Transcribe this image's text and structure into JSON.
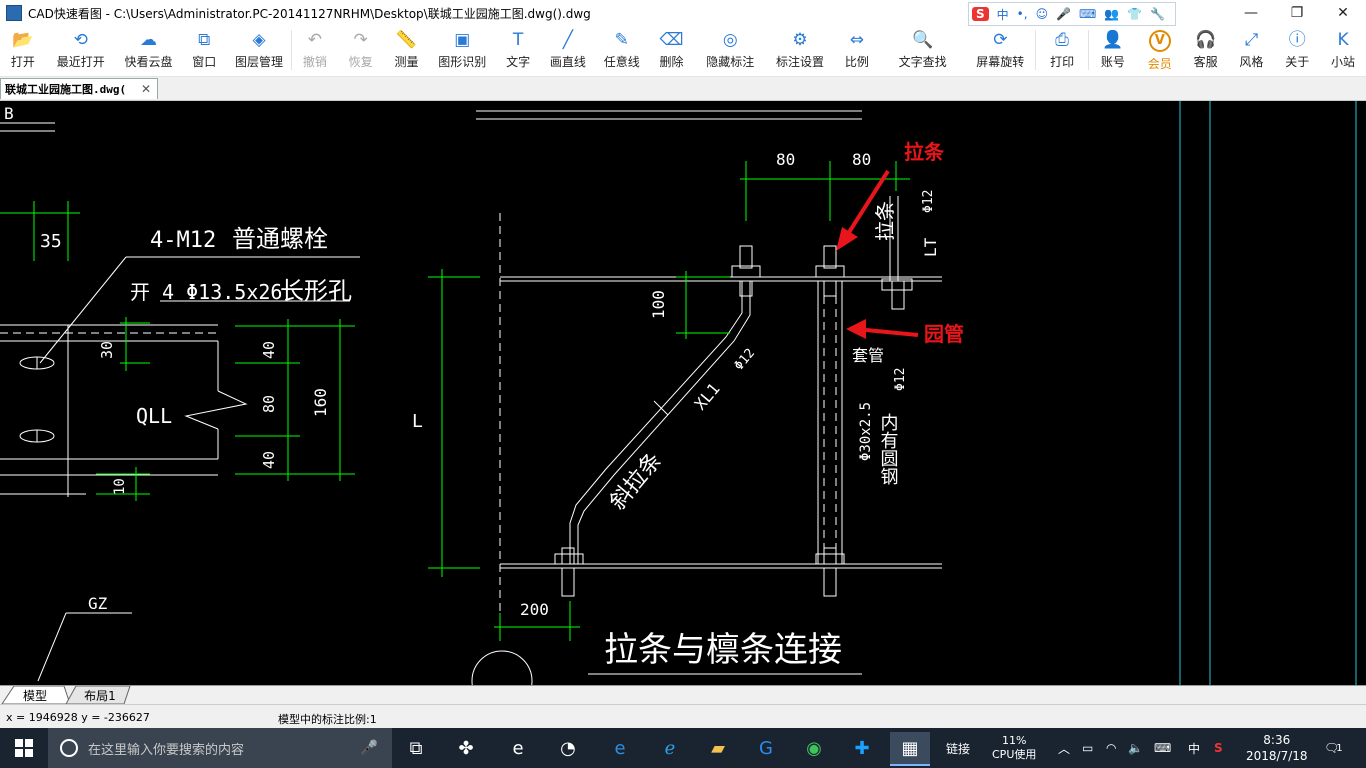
{
  "window": {
    "title": "CAD快速看图 - C:\\Users\\Administrator.PC-20141127NRHM\\Desktop\\联城工业园施工图.dwg().dwg",
    "minimize": "—",
    "maximize": "❐",
    "close": "✕"
  },
  "ime": {
    "logo": "S",
    "mode": "中",
    "punct": "•,"
  },
  "toolbar": {
    "items": [
      {
        "label": "打开",
        "icon": "folder-icon",
        "glyph": "📂"
      },
      {
        "label": "最近打开",
        "icon": "history-icon",
        "glyph": "⟲"
      },
      {
        "label": "快看云盘",
        "icon": "cloud-icon",
        "glyph": "☁"
      },
      {
        "label": "窗口",
        "icon": "window-icon",
        "glyph": "⧉"
      },
      {
        "label": "图层管理",
        "icon": "layers-icon",
        "glyph": "◈"
      },
      {
        "label": "撤销",
        "icon": "undo-icon",
        "glyph": "↶"
      },
      {
        "label": "恢复",
        "icon": "redo-icon",
        "glyph": "↷"
      },
      {
        "label": "测量",
        "icon": "ruler-icon",
        "glyph": "📏"
      },
      {
        "label": "图形识别",
        "icon": "shape-recognize-icon",
        "glyph": "▣"
      },
      {
        "label": "文字",
        "icon": "text-icon",
        "glyph": "T"
      },
      {
        "label": "画直线",
        "icon": "line-icon",
        "glyph": "╱"
      },
      {
        "label": "任意线",
        "icon": "pen-icon",
        "glyph": "✎"
      },
      {
        "label": "删除",
        "icon": "eraser-icon",
        "glyph": "⌫"
      },
      {
        "label": "隐藏标注",
        "icon": "eye-hide-icon",
        "glyph": "◎"
      },
      {
        "label": "标注设置",
        "icon": "gear-icon",
        "glyph": "⚙"
      },
      {
        "label": "比例",
        "icon": "scale-icon",
        "glyph": "⇔"
      },
      {
        "label": "文字查找",
        "icon": "text-search-icon",
        "glyph": "🔍"
      },
      {
        "label": "屏幕旋转",
        "icon": "rotate-icon",
        "glyph": "⟳"
      },
      {
        "label": "打印",
        "icon": "printer-icon",
        "glyph": "⎙"
      },
      {
        "label": "账号",
        "icon": "user-icon",
        "glyph": "👤"
      },
      {
        "label": "会员",
        "icon": "vip-icon",
        "glyph": "V"
      },
      {
        "label": "客服",
        "icon": "headset-icon",
        "glyph": "🎧"
      },
      {
        "label": "风格",
        "icon": "style-icon",
        "glyph": "⤢"
      },
      {
        "label": "关于",
        "icon": "info-icon",
        "glyph": "ⓘ"
      },
      {
        "label": "小站",
        "icon": "site-icon",
        "glyph": "K"
      }
    ]
  },
  "doctab": {
    "label": "联城工业园施工图.dwg(",
    "close": "✕"
  },
  "drawing": {
    "dim_80_left": "80",
    "dim_80_right": "80",
    "annot_tiaotiao": "拉条",
    "annot_yuanguan": "园管",
    "label_4m12": "4-M12",
    "label_bolt": "普通螺栓",
    "label_hole": "开 4 Φ13.5x26",
    "label_slot": "长形孔",
    "dim_35": "35",
    "dim_30": "30",
    "dim_40_top": "40",
    "dim_80_mid": "80",
    "dim_160": "160",
    "dim_40_bot": "40",
    "dim_10": "10",
    "label_qll": "QLL",
    "dim_100": "100",
    "label_L": "L",
    "label_LT": "LT",
    "label_xl1": "XL1",
    "label_phi12_a": "Φ12",
    "label_phi12_b": "Φ12",
    "label_phi12_c": "Φ12",
    "label_lt_vert": "拉条",
    "label_taoguan": "套管",
    "label_pipe": "Φ30x2.5",
    "label_rebar": "内有圆钢",
    "label_diag": "斜拉条",
    "dim_200": "200",
    "label_gz": "GZ",
    "label_title": "拉条与檩条连接",
    "label_B": "B"
  },
  "layout_tabs": {
    "model": "模型",
    "layout1": "布局1"
  },
  "status": {
    "coord": "x = 1946928  y = -236627",
    "scale": "模型中的标注比例:1"
  },
  "taskbar": {
    "search_placeholder": "在这里输入你要搜索的内容",
    "link": "链接",
    "cpu_percent": "11%",
    "cpu_label": "CPU使用",
    "lang": "中",
    "time": "8:36",
    "date": "2018/7/18",
    "notif_count": "1"
  }
}
